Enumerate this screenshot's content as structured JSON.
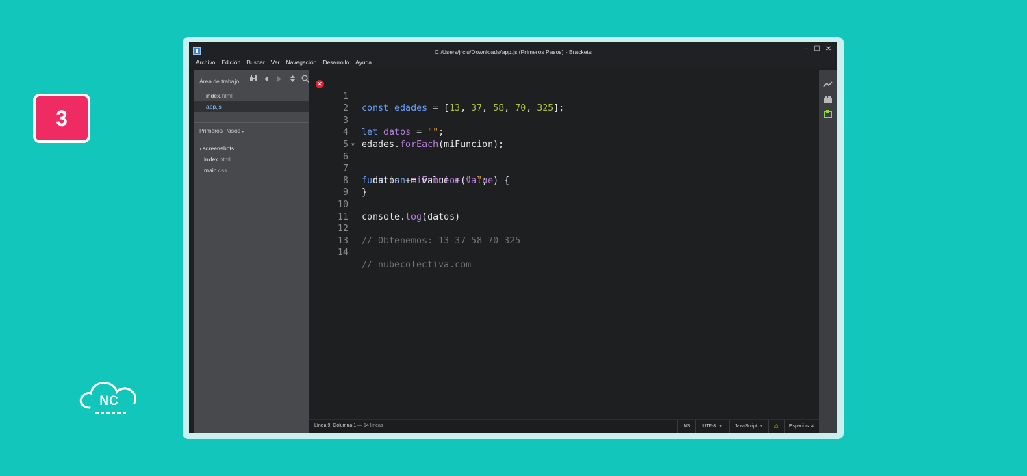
{
  "badge": {
    "number": "3"
  },
  "logo": {
    "text": "NC"
  },
  "window": {
    "title": "C:/Users/jrclu/Downloads/app.js (Primeros Pasos) - Brackets",
    "controls": {
      "minimize": "–",
      "maximize": "☐",
      "close": "✕"
    }
  },
  "menu": [
    "Archivo",
    "Edición",
    "Buscar",
    "Ver",
    "Navegación",
    "Desarrollo",
    "Ayuda"
  ],
  "sidebar": {
    "working_set_title": "Área de trabajo",
    "working_files": [
      {
        "name": "index",
        "ext": ".html"
      },
      {
        "name": "app",
        "ext": ".js"
      }
    ],
    "project_title": "Primeros Pasos",
    "project_caret": "▾",
    "tree": [
      {
        "name": "screenshots",
        "ext": "",
        "prefix": "› "
      },
      {
        "name": "index",
        "ext": ".html",
        "prefix": ""
      },
      {
        "name": "main",
        "ext": ".css",
        "prefix": ""
      }
    ]
  },
  "editor": {
    "error_icon": "✕",
    "line_numbers": [
      "1",
      "2",
      "3",
      "4",
      "5",
      "6",
      "7",
      "8",
      "9",
      "10",
      "11",
      "12",
      "13",
      "14"
    ],
    "fold_marker": "▼",
    "code": {
      "l1": {
        "kw": "const",
        "sp1": " ",
        "var": "edades",
        "eq": " = [",
        "n1": "13",
        "c1": ", ",
        "n2": "37",
        "c2": ", ",
        "n3": "58",
        "c3": ", ",
        "n4": "70",
        "c4": ", ",
        "n5": "325",
        "end": "];"
      },
      "l3": {
        "kw": "let",
        "sp1": " ",
        "var": "datos",
        "eq": " = ",
        "str": "\"\"",
        "end": ";"
      },
      "l4": {
        "obj": "edades.",
        "fn": "forEach",
        "rest": "(miFuncion);"
      },
      "l6": {
        "kw": "function",
        "sp1": " ",
        "fn": "miFuncion",
        "p1": "(",
        "param": "value",
        "p2": ") {"
      },
      "l7": {
        "pre": "  datos += value + ",
        "str": "\" \"",
        "end": ";"
      },
      "l8": {
        "text": "}"
      },
      "l10": {
        "obj": "console.",
        "fn": "log",
        "rest": "(datos)"
      },
      "l12": {
        "text": "// Obtenemos: 13 37 58 70 325"
      },
      "l14": {
        "text": "// nubecolectiva.com"
      }
    }
  },
  "status": {
    "position": "Línea 9, Columna 1",
    "lines": " — 14 líneas",
    "mode": "INS",
    "encoding": "UTF-8",
    "language": "JavaScript",
    "warning_icon": "⚠",
    "spaces": "Espacios: 4"
  },
  "colors": {
    "background": "#13c6bb",
    "badge": "#ee2b62",
    "keyword": "#6c9ef8",
    "function": "#b77fdb",
    "number": "#a6c13c",
    "string": "#d89333",
    "comment": "#767676"
  },
  "rightbar_icons": [
    "live-preview-icon",
    "extension-manager-icon",
    "extension-icon"
  ]
}
